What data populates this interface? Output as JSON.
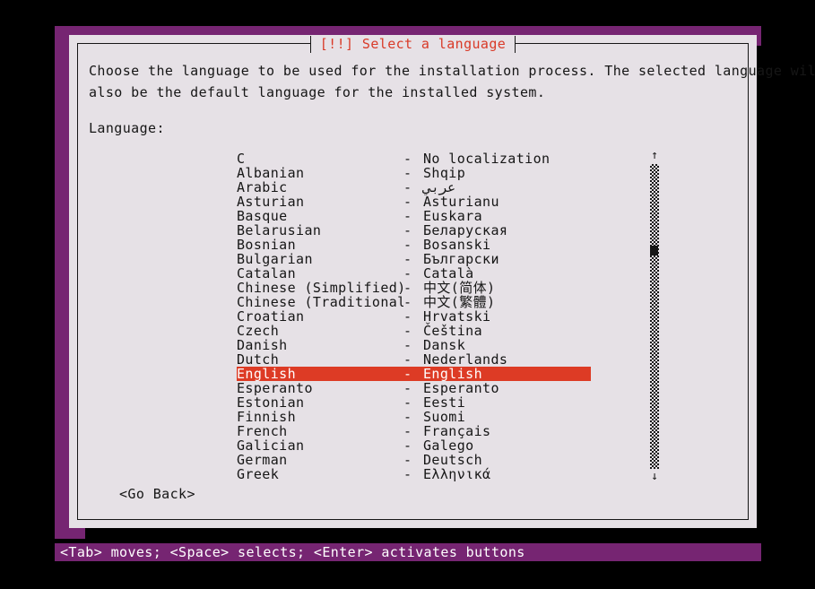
{
  "window": {
    "title": "[!!] Select a language",
    "title_color": "#d93a28",
    "backdrop_color": "#762572",
    "dialog_bg": "#e6e1e6",
    "text_color": "#161616",
    "highlight_bg": "#dd3b25",
    "highlight_fg": "#ffffff"
  },
  "description": {
    "line1": "Choose the language to be used for the installation process. The selected language will",
    "line2": "also be the default language for the installed system."
  },
  "list_label": "Language:",
  "languages": [
    {
      "name": "C",
      "dash": "-",
      "native": "No localization",
      "selected": false
    },
    {
      "name": "Albanian",
      "dash": "-",
      "native": "Shqip",
      "selected": false
    },
    {
      "name": "Arabic",
      "dash": "-",
      "native": "عربي",
      "selected": false
    },
    {
      "name": "Asturian",
      "dash": "-",
      "native": "Asturianu",
      "selected": false
    },
    {
      "name": "Basque",
      "dash": "-",
      "native": "Euskara",
      "selected": false
    },
    {
      "name": "Belarusian",
      "dash": "-",
      "native": "Беларуская",
      "selected": false
    },
    {
      "name": "Bosnian",
      "dash": "-",
      "native": "Bosanski",
      "selected": false
    },
    {
      "name": "Bulgarian",
      "dash": "-",
      "native": "Български",
      "selected": false
    },
    {
      "name": "Catalan",
      "dash": "-",
      "native": "Català",
      "selected": false
    },
    {
      "name": "Chinese (Simplified)",
      "dash": "-",
      "native": "中文(简体)",
      "selected": false
    },
    {
      "name": "Chinese (Traditional)",
      "dash": "-",
      "native": "中文(繁體)",
      "selected": false
    },
    {
      "name": "Croatian",
      "dash": "-",
      "native": "Hrvatski",
      "selected": false
    },
    {
      "name": "Czech",
      "dash": "-",
      "native": "Čeština",
      "selected": false
    },
    {
      "name": "Danish",
      "dash": "-",
      "native": "Dansk",
      "selected": false
    },
    {
      "name": "Dutch",
      "dash": "-",
      "native": "Nederlands",
      "selected": false
    },
    {
      "name": "English",
      "dash": "-",
      "native": "English",
      "selected": true
    },
    {
      "name": "Esperanto",
      "dash": "-",
      "native": "Esperanto",
      "selected": false
    },
    {
      "name": "Estonian",
      "dash": "-",
      "native": "Eesti",
      "selected": false
    },
    {
      "name": "Finnish",
      "dash": "-",
      "native": "Suomi",
      "selected": false
    },
    {
      "name": "French",
      "dash": "-",
      "native": "Français",
      "selected": false
    },
    {
      "name": "Galician",
      "dash": "-",
      "native": "Galego",
      "selected": false
    },
    {
      "name": "German",
      "dash": "-",
      "native": "Deutsch",
      "selected": false
    },
    {
      "name": "Greek",
      "dash": "-",
      "native": "Ελληνικά",
      "selected": false
    }
  ],
  "scrollbar": {
    "up_arrow": "↑",
    "down_arrow": "↓"
  },
  "buttons": {
    "go_back": "<Go Back>"
  },
  "statusbar": {
    "text": "<Tab> moves; <Space> selects; <Enter> activates buttons"
  }
}
